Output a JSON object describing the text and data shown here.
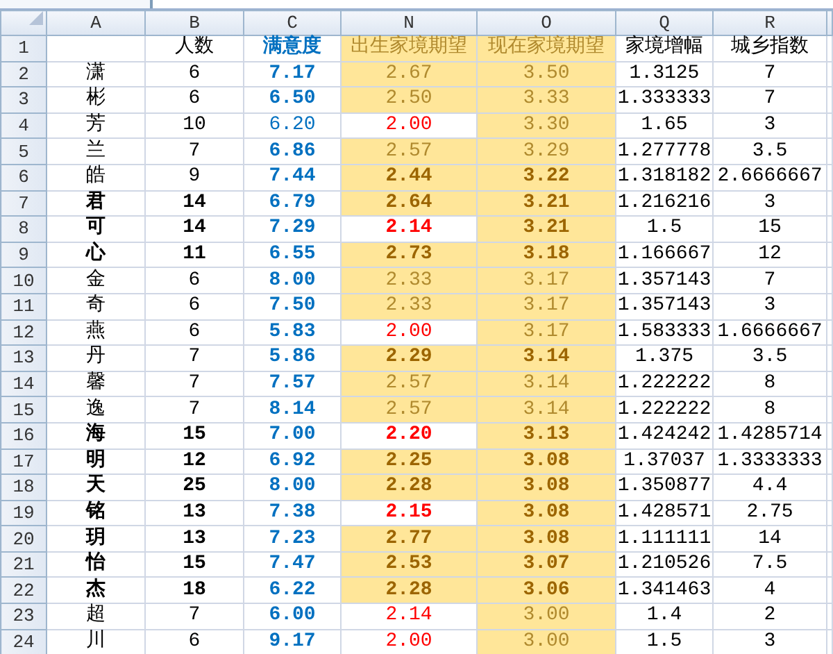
{
  "columns": [
    "A",
    "B",
    "C",
    "N",
    "O",
    "Q",
    "R"
  ],
  "header_row": {
    "row": "1",
    "count": "人数",
    "satisfaction": "满意度",
    "birth": "出生家境期望",
    "current": "现在家境期望",
    "growth": "家境增幅",
    "index": "城乡指数"
  },
  "rows": [
    {
      "row": "2",
      "name": "潇",
      "count": "6",
      "satisfaction": "7.17",
      "birth": "2.67",
      "current": "3.50",
      "growth": "1.3125",
      "index": "7",
      "strong": false,
      "satisfaction_bold": true,
      "birth_low": false,
      "scores_bold": false
    },
    {
      "row": "3",
      "name": "彬",
      "count": "6",
      "satisfaction": "6.50",
      "birth": "2.50",
      "current": "3.33",
      "growth": "1.333333",
      "index": "7",
      "strong": false,
      "satisfaction_bold": true,
      "birth_low": false,
      "scores_bold": false
    },
    {
      "row": "4",
      "name": "芳",
      "count": "10",
      "satisfaction": "6.20",
      "birth": "2.00",
      "current": "3.30",
      "growth": "1.65",
      "index": "3",
      "strong": false,
      "satisfaction_bold": false,
      "birth_low": true,
      "scores_bold": false
    },
    {
      "row": "5",
      "name": "兰",
      "count": "7",
      "satisfaction": "6.86",
      "birth": "2.57",
      "current": "3.29",
      "growth": "1.277778",
      "index": "3.5",
      "strong": false,
      "satisfaction_bold": true,
      "birth_low": false,
      "scores_bold": false
    },
    {
      "row": "6",
      "name": "皓",
      "count": "9",
      "satisfaction": "7.44",
      "birth": "2.44",
      "current": "3.22",
      "growth": "1.318182",
      "index": "2.6666667",
      "strong": false,
      "satisfaction_bold": true,
      "birth_low": false,
      "scores_bold": true
    },
    {
      "row": "7",
      "name": "君",
      "count": "14",
      "satisfaction": "6.79",
      "birth": "2.64",
      "current": "3.21",
      "growth": "1.216216",
      "index": "3",
      "strong": true,
      "satisfaction_bold": true,
      "birth_low": false,
      "scores_bold": true
    },
    {
      "row": "8",
      "name": "可",
      "count": "14",
      "satisfaction": "7.29",
      "birth": "2.14",
      "current": "3.21",
      "growth": "1.5",
      "index": "15",
      "strong": true,
      "satisfaction_bold": true,
      "birth_low": true,
      "scores_bold": true
    },
    {
      "row": "9",
      "name": "心",
      "count": "11",
      "satisfaction": "6.55",
      "birth": "2.73",
      "current": "3.18",
      "growth": "1.166667",
      "index": "12",
      "strong": true,
      "satisfaction_bold": true,
      "birth_low": false,
      "scores_bold": true
    },
    {
      "row": "10",
      "name": "金",
      "count": "6",
      "satisfaction": "8.00",
      "birth": "2.33",
      "current": "3.17",
      "growth": "1.357143",
      "index": "7",
      "strong": false,
      "satisfaction_bold": true,
      "birth_low": false,
      "scores_bold": false
    },
    {
      "row": "11",
      "name": "奇",
      "count": "6",
      "satisfaction": "7.50",
      "birth": "2.33",
      "current": "3.17",
      "growth": "1.357143",
      "index": "3",
      "strong": false,
      "satisfaction_bold": true,
      "birth_low": false,
      "scores_bold": false
    },
    {
      "row": "12",
      "name": "燕",
      "count": "6",
      "satisfaction": "5.83",
      "birth": "2.00",
      "current": "3.17",
      "growth": "1.583333",
      "index": "1.6666667",
      "strong": false,
      "satisfaction_bold": true,
      "birth_low": true,
      "scores_bold": false
    },
    {
      "row": "13",
      "name": "丹",
      "count": "7",
      "satisfaction": "5.86",
      "birth": "2.29",
      "current": "3.14",
      "growth": "1.375",
      "index": "3.5",
      "strong": false,
      "satisfaction_bold": true,
      "birth_low": false,
      "scores_bold": true
    },
    {
      "row": "14",
      "name": "馨",
      "count": "7",
      "satisfaction": "7.57",
      "birth": "2.57",
      "current": "3.14",
      "growth": "1.222222",
      "index": "8",
      "strong": false,
      "satisfaction_bold": true,
      "birth_low": false,
      "scores_bold": false
    },
    {
      "row": "15",
      "name": "逸",
      "count": "7",
      "satisfaction": "8.14",
      "birth": "2.57",
      "current": "3.14",
      "growth": "1.222222",
      "index": "8",
      "strong": false,
      "satisfaction_bold": true,
      "birth_low": false,
      "scores_bold": false
    },
    {
      "row": "16",
      "name": "海",
      "count": "15",
      "satisfaction": "7.00",
      "birth": "2.20",
      "current": "3.13",
      "growth": "1.424242",
      "index": "1.4285714",
      "strong": true,
      "satisfaction_bold": true,
      "birth_low": true,
      "scores_bold": true
    },
    {
      "row": "17",
      "name": "明",
      "count": "12",
      "satisfaction": "6.92",
      "birth": "2.25",
      "current": "3.08",
      "growth": "1.37037",
      "index": "1.3333333",
      "strong": true,
      "satisfaction_bold": true,
      "birth_low": false,
      "scores_bold": true
    },
    {
      "row": "18",
      "name": "天",
      "count": "25",
      "satisfaction": "8.00",
      "birth": "2.28",
      "current": "3.08",
      "growth": "1.350877",
      "index": "4.4",
      "strong": true,
      "satisfaction_bold": true,
      "birth_low": false,
      "scores_bold": true
    },
    {
      "row": "19",
      "name": "铭",
      "count": "13",
      "satisfaction": "7.38",
      "birth": "2.15",
      "current": "3.08",
      "growth": "1.428571",
      "index": "2.75",
      "strong": true,
      "satisfaction_bold": true,
      "birth_low": true,
      "scores_bold": true
    },
    {
      "row": "20",
      "name": "玥",
      "count": "13",
      "satisfaction": "7.23",
      "birth": "2.77",
      "current": "3.08",
      "growth": "1.111111",
      "index": "14",
      "strong": true,
      "satisfaction_bold": true,
      "birth_low": false,
      "scores_bold": true
    },
    {
      "row": "21",
      "name": "怡",
      "count": "15",
      "satisfaction": "7.47",
      "birth": "2.53",
      "current": "3.07",
      "growth": "1.210526",
      "index": "7.5",
      "strong": true,
      "satisfaction_bold": true,
      "birth_low": false,
      "scores_bold": true
    },
    {
      "row": "22",
      "name": "杰",
      "count": "18",
      "satisfaction": "6.22",
      "birth": "2.28",
      "current": "3.06",
      "growth": "1.341463",
      "index": "4",
      "strong": true,
      "satisfaction_bold": true,
      "birth_low": false,
      "scores_bold": true
    },
    {
      "row": "23",
      "name": "超",
      "count": "7",
      "satisfaction": "6.00",
      "birth": "2.14",
      "current": "3.00",
      "growth": "1.4",
      "index": "2",
      "strong": false,
      "satisfaction_bold": true,
      "birth_low": true,
      "scores_bold": false
    },
    {
      "row": "24",
      "name": "川",
      "count": "6",
      "satisfaction": "9.17",
      "birth": "2.00",
      "current": "3.00",
      "growth": "1.5",
      "index": "3",
      "strong": false,
      "satisfaction_bold": true,
      "birth_low": true,
      "scores_bold": false
    }
  ]
}
